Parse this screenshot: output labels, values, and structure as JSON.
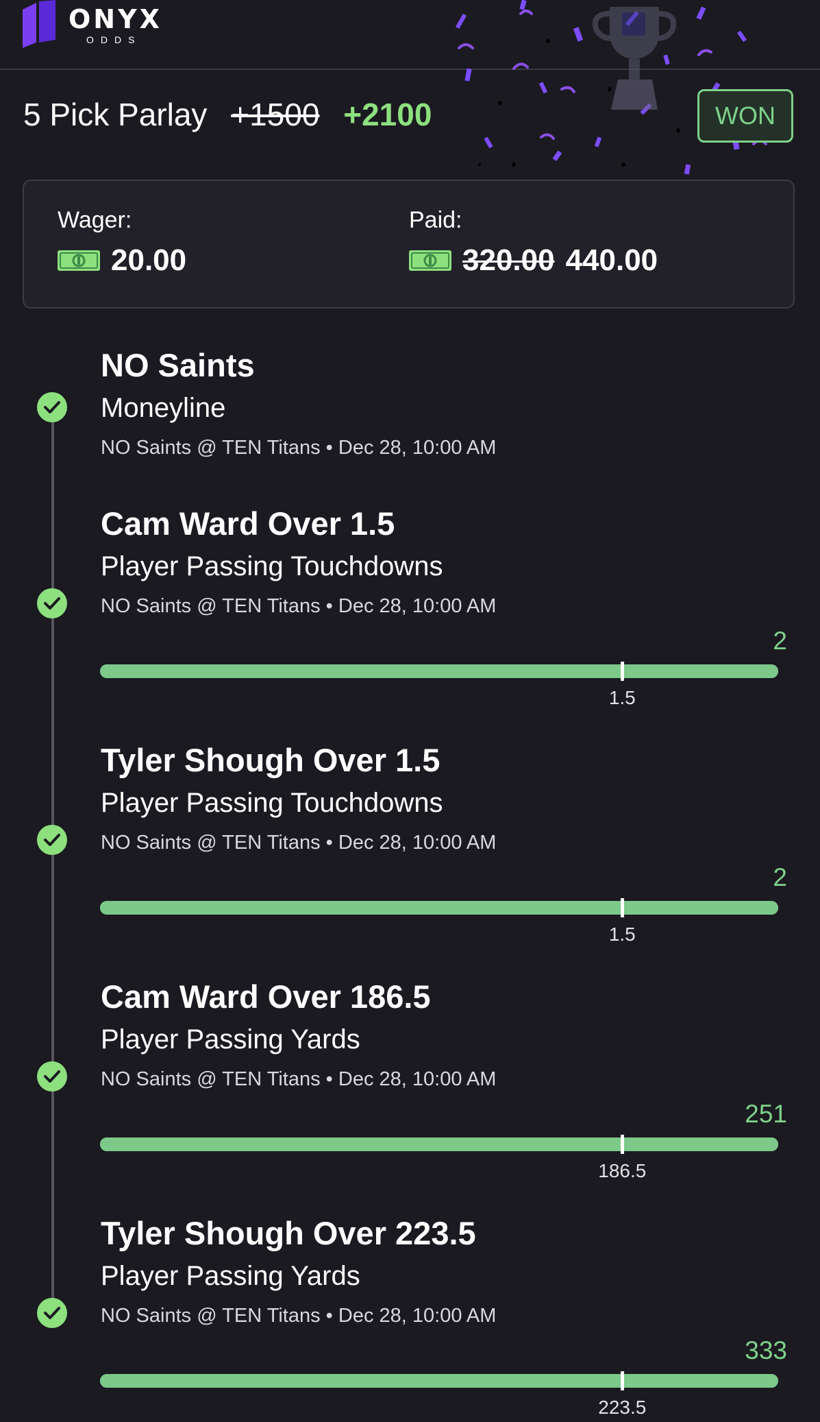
{
  "brand": {
    "name": "ONYX",
    "sub": "ODDS"
  },
  "bet": {
    "title": "5 Pick Parlay",
    "old_odds": "+1500",
    "new_odds": "+2100",
    "status": "WON"
  },
  "wager": {
    "label": "Wager:",
    "amount": "20.00",
    "paid_label": "Paid:",
    "paid_old": "320.00",
    "paid_new": "440.00"
  },
  "colors": {
    "accent_green": "#7ed28a",
    "background": "#1b1a21",
    "confetti": "#7c4dff"
  },
  "picks": [
    {
      "title": "NO Saints",
      "market": "Moneyline",
      "game": "NO Saints @ TEN Titans • Dec 28, 10:00 AM",
      "result_icon": "check-circle-icon"
    },
    {
      "title": "Cam Ward Over 1.5",
      "market": "Player Passing Touchdowns",
      "game": "NO Saints @ TEN Titans • Dec 28, 10:00 AM",
      "actual": "2",
      "line": "1.5",
      "progress": 1.0,
      "line_position": 0.77,
      "result_icon": "check-circle-icon"
    },
    {
      "title": "Tyler Shough Over 1.5",
      "market": "Player Passing Touchdowns",
      "game": "NO Saints @ TEN Titans • Dec 28, 10:00 AM",
      "actual": "2",
      "line": "1.5",
      "progress": 1.0,
      "line_position": 0.77,
      "result_icon": "check-circle-icon"
    },
    {
      "title": "Cam Ward Over 186.5",
      "market": "Player Passing Yards",
      "game": "NO Saints @ TEN Titans • Dec 28, 10:00 AM",
      "actual": "251",
      "line": "186.5",
      "progress": 1.0,
      "line_position": 0.77,
      "result_icon": "check-circle-icon"
    },
    {
      "title": "Tyler Shough Over 223.5",
      "market": "Player Passing Yards",
      "game": "NO Saints @ TEN Titans • Dec 28, 10:00 AM",
      "actual": "333",
      "line": "223.5",
      "progress": 1.0,
      "line_position": 0.77,
      "result_icon": "check-circle-icon"
    }
  ]
}
